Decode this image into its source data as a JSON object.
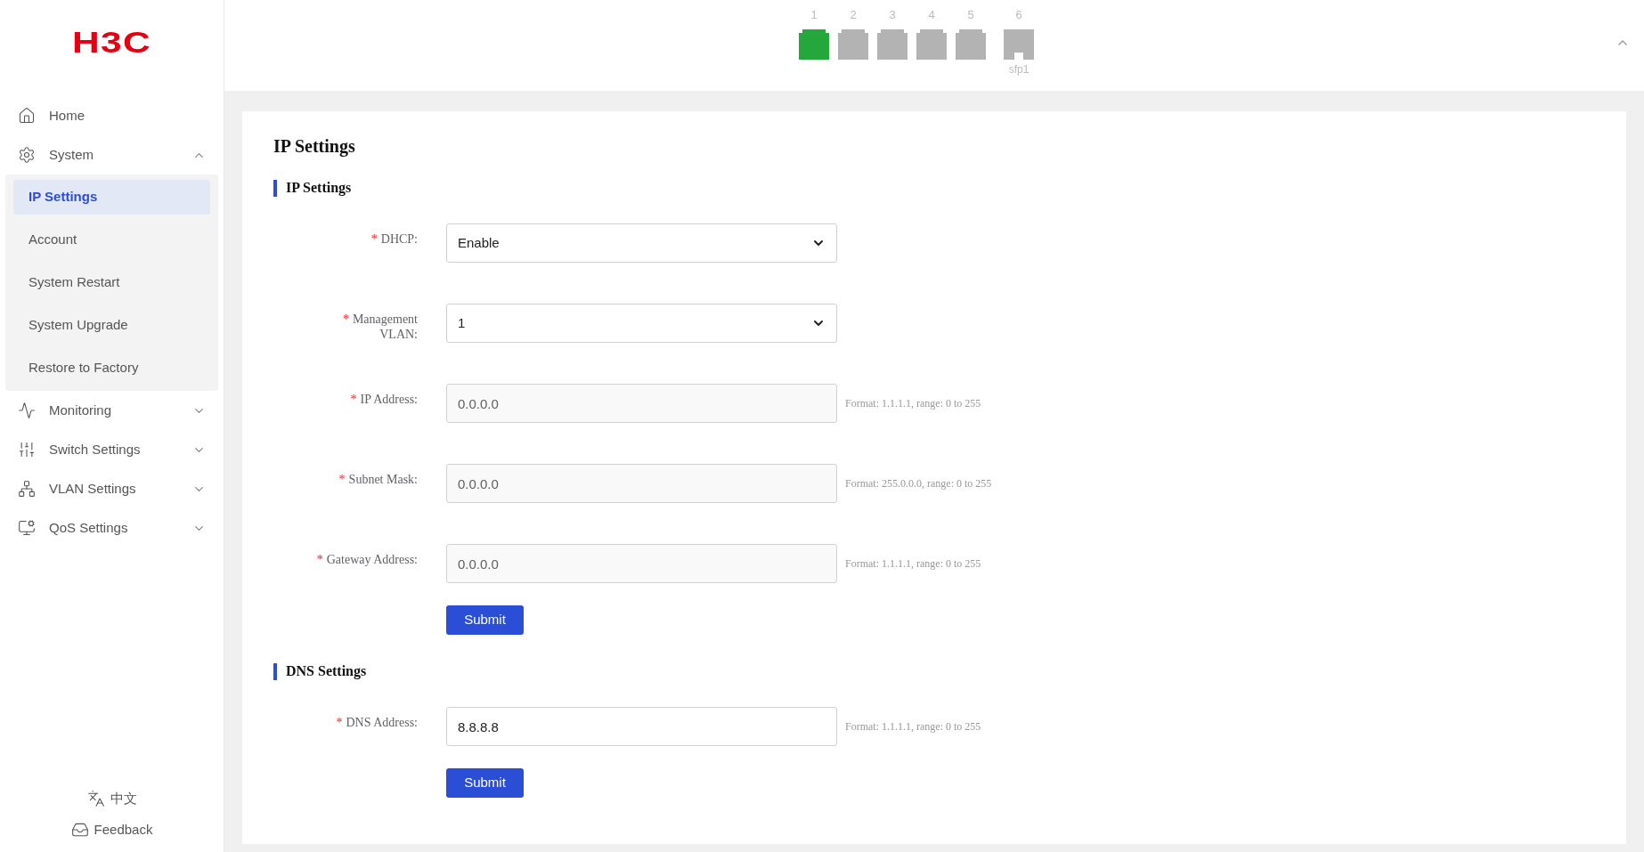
{
  "logo": "H3C",
  "sidebar": {
    "items": [
      {
        "label": "Home",
        "kind": "link"
      },
      {
        "label": "System",
        "kind": "group",
        "expanded": true,
        "children": [
          {
            "label": "IP Settings",
            "selected": true
          },
          {
            "label": "Account",
            "selected": false
          },
          {
            "label": "System Restart",
            "selected": false
          },
          {
            "label": "System Upgrade",
            "selected": false
          },
          {
            "label": "Restore to Factory",
            "selected": false
          }
        ]
      },
      {
        "label": "Monitoring",
        "kind": "group",
        "expanded": false
      },
      {
        "label": "Switch Settings",
        "kind": "group",
        "expanded": false
      },
      {
        "label": "VLAN Settings",
        "kind": "group",
        "expanded": false
      },
      {
        "label": "QoS Settings",
        "kind": "group",
        "expanded": false
      }
    ],
    "language": "中文",
    "feedback": "Feedback"
  },
  "ports": [
    {
      "number": "1",
      "kind": "rj45",
      "up": true
    },
    {
      "number": "2",
      "kind": "rj45",
      "up": false
    },
    {
      "number": "3",
      "kind": "rj45",
      "up": false
    },
    {
      "number": "4",
      "kind": "rj45",
      "up": false
    },
    {
      "number": "5",
      "kind": "rj45",
      "up": false
    },
    {
      "number": "6",
      "kind": "sfp",
      "up": false,
      "label": "sfp1"
    }
  ],
  "page_title": "IP Settings",
  "sections": [
    {
      "heading": "IP Settings",
      "fields": [
        {
          "label": "DHCP:",
          "kind": "select",
          "mark": "*",
          "value": "Enable",
          "disabled": false
        },
        {
          "label": "Management VLAN:",
          "kind": "select",
          "mark": "*",
          "value": "1",
          "disabled": false
        },
        {
          "label": "IP Address:",
          "kind": "text",
          "mark": "*",
          "value": "0.0.0.0",
          "disabled": true,
          "hint": "Format: 1.1.1.1, range: 0 to 255"
        },
        {
          "label": "Subnet Mask:",
          "kind": "text",
          "mark": "*",
          "value": "0.0.0.0",
          "disabled": true,
          "hint": "Format: 255.0.0.0, range: 0 to 255"
        },
        {
          "label": "Gateway Address:",
          "kind": "text",
          "mark": "*",
          "value": "0.0.0.0",
          "disabled": true,
          "hint": "Format: 1.1.1.1, range: 0 to 255"
        }
      ],
      "button": "Submit"
    },
    {
      "heading": "DNS Settings",
      "fields": [
        {
          "label": "DNS Address:",
          "kind": "text",
          "mark": "*",
          "value": "8.8.8.8",
          "disabled": false,
          "hint": "Format: 1.1.1.1, range: 0 to 255"
        }
      ],
      "button": "Submit"
    }
  ]
}
